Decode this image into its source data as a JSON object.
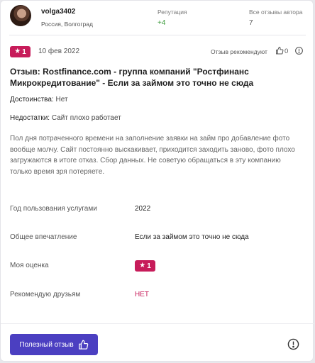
{
  "author": {
    "username": "volga3402",
    "location": "Россия, Волгоград"
  },
  "stats": {
    "reputation_label": "Репутация",
    "reputation_value": "+4",
    "all_reviews_label": "Все отзывы автора",
    "all_reviews_value": "7"
  },
  "review": {
    "rating": "1",
    "date": "10 фев 2022",
    "recommended_label": "Отзыв рекомендуют",
    "likes": "0",
    "title": "Отзыв: Rostfinance.com - группа компаний \"Ростфинанс Микрокредитование\" - Если за займом это точно не сюда",
    "pros_label": "Достоинства:",
    "pros_value": "Нет",
    "cons_label": "Недостатки:",
    "cons_value": "Сайт плохо работает",
    "text": "Пол дня потраченного времени на заполнение заявки на займ про добавление фото вообще молчу. Сайт постоянно выскакивает, приходится заходить заново, фото плохо загружаются в итоге отказ. Сбор данных. Не советую обращаться в эту компанию только время зря потеряете."
  },
  "details": {
    "year_label": "Год пользования услугами",
    "year_value": "2022",
    "impression_label": "Общее впечатление",
    "impression_value": "Если за займом это точно не сюда",
    "score_label": "Моя оценка",
    "score_value": "1",
    "recommend_label": "Рекомендую друзьям",
    "recommend_value": "НЕТ"
  },
  "footer": {
    "useful_button": "Полезный отзыв"
  },
  "icons": {
    "star": "star-icon",
    "like": "thumbs-up-icon",
    "more": "more-icon",
    "report": "exclamation-circle-icon"
  },
  "colors": {
    "badge": "#c71c5a",
    "button": "#4b3fc1",
    "reputation": "#3a9a3a"
  }
}
